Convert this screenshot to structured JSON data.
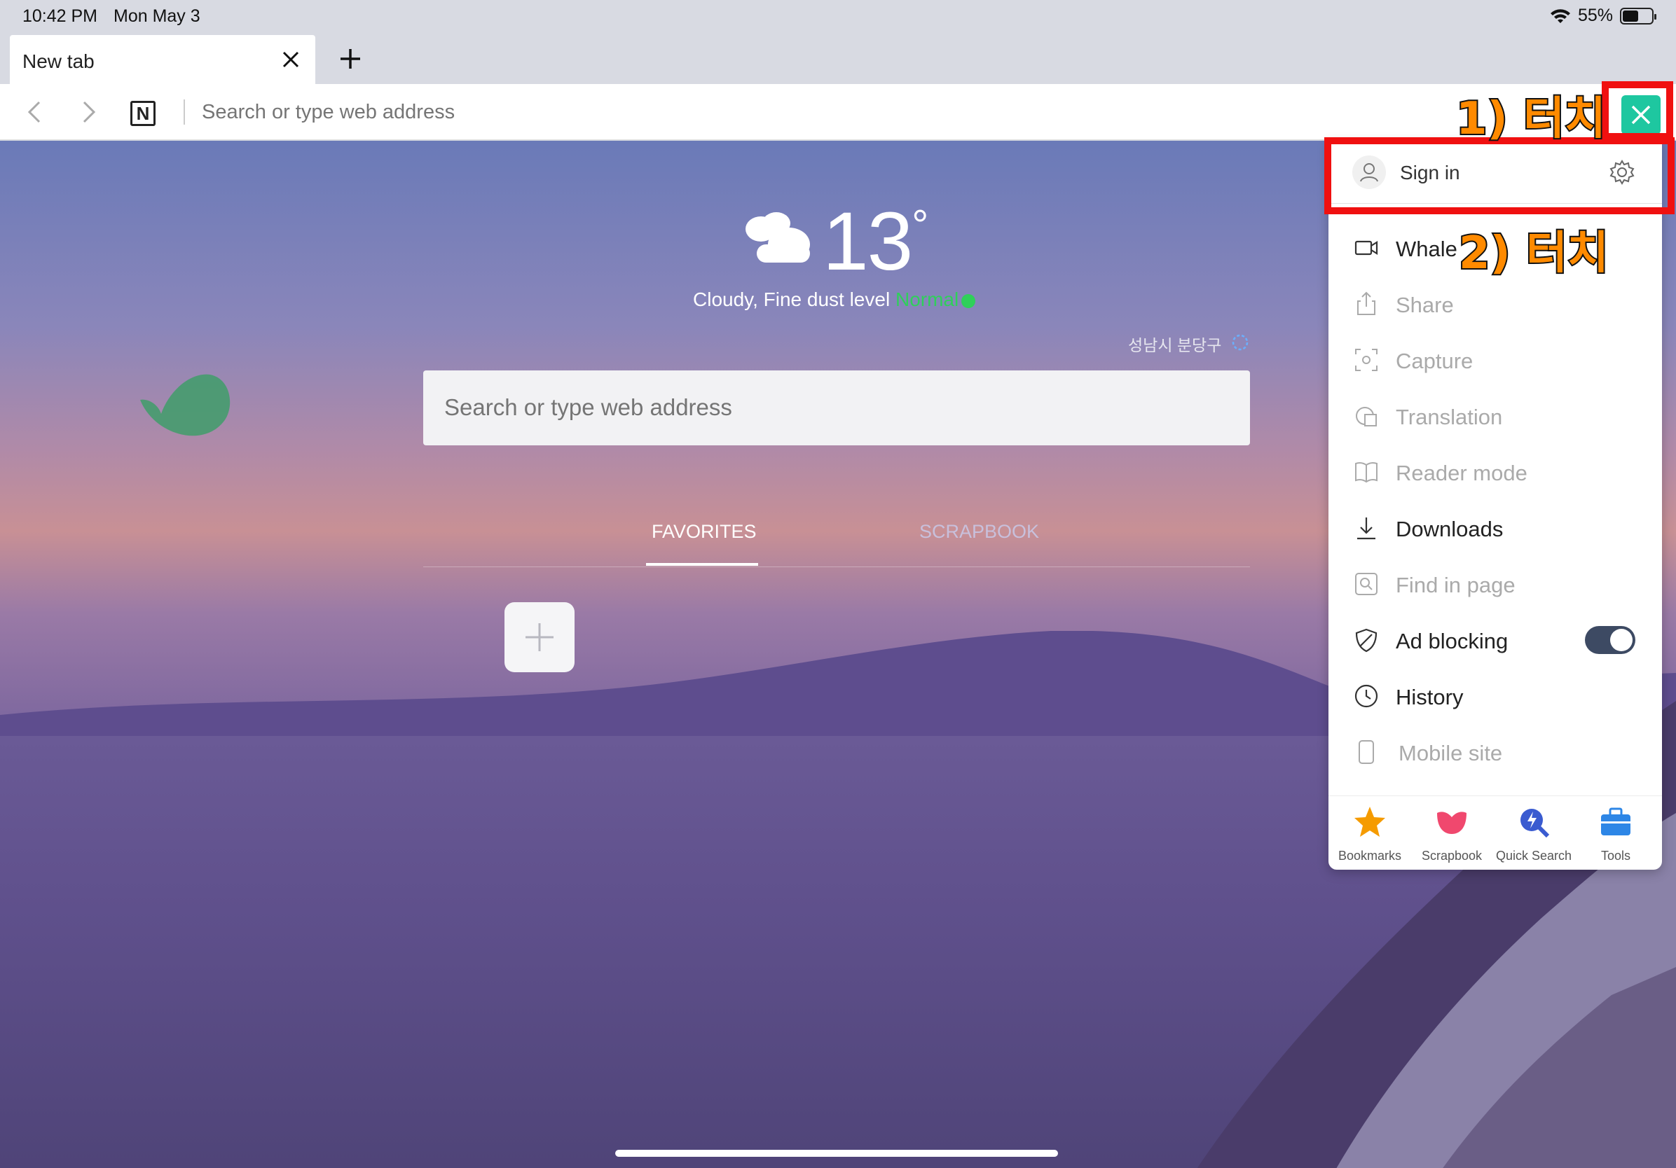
{
  "status_bar": {
    "time": "10:42 PM",
    "date": "Mon May 3",
    "battery": "55%",
    "battery_level": 0.55
  },
  "tab": {
    "title": "New tab"
  },
  "toolbar": {
    "address_placeholder": "Search or type web address",
    "logo_letter": "N",
    "tab_count": "1"
  },
  "home": {
    "temperature": "13",
    "degree": "°",
    "weather_text": "Cloudy, Fine dust level ",
    "dust_status": "Normal",
    "location": "성남시 분당구",
    "search_placeholder": "Search or type web address",
    "tabs": [
      "FAVORITES",
      "SCRAPBOOK"
    ]
  },
  "menu": {
    "signin_label": "Sign in",
    "items": [
      {
        "label": "Whale",
        "enabled": true
      },
      {
        "label": "Share",
        "enabled": false
      },
      {
        "label": "Capture",
        "enabled": false
      },
      {
        "label": "Translation",
        "enabled": false
      },
      {
        "label": "Reader mode",
        "enabled": false
      },
      {
        "label": "Downloads",
        "enabled": true
      },
      {
        "label": "Find in page",
        "enabled": false
      },
      {
        "label": "Ad blocking",
        "enabled": true,
        "toggle": true
      },
      {
        "label": "History",
        "enabled": true
      },
      {
        "label": "Mobile site",
        "enabled": false
      }
    ],
    "ad_blocking_on": true,
    "dock": [
      {
        "label": "Bookmarks",
        "icon": "star-icon",
        "color": "#f59b00"
      },
      {
        "label": "Scrapbook",
        "icon": "scrapbook-icon",
        "color": "#f0486e"
      },
      {
        "label": "Quick Search",
        "icon": "quick-search-icon",
        "color": "#3a5bd0"
      },
      {
        "label": "Tools",
        "icon": "tools-icon",
        "color": "#2d86e6"
      }
    ]
  },
  "annotations": {
    "step1": "1) 터치",
    "step2": "2) 터치",
    "highlight_color": "#f01010"
  }
}
